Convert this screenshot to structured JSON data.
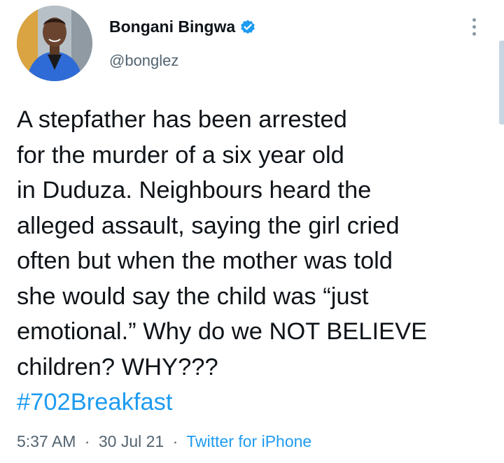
{
  "author": {
    "display_name": "Bongani Bingwa",
    "handle": "@bonglez",
    "verified": true
  },
  "tweet": {
    "lines": [
      "A stepfather has been arrested",
      "for the murder of a six year old",
      "in Duduza. Neighbours heard the",
      "alleged assault, saying the girl cried",
      "often but when the mother was told",
      "she would say the child was “just",
      "emotional.” Why do we NOT BELIEVE",
      "children? WHY???"
    ],
    "hashtag": "#702Breakfast"
  },
  "meta": {
    "time": "5:37 AM",
    "date": "30 Jul 21",
    "separator": "·",
    "source": "Twitter for iPhone"
  },
  "icons": {
    "verified": "verified-badge-icon",
    "more": "more-options-icon"
  },
  "colors": {
    "link": "#1d9bf0",
    "secondary_text": "#536471",
    "primary_text": "#0f1419"
  }
}
